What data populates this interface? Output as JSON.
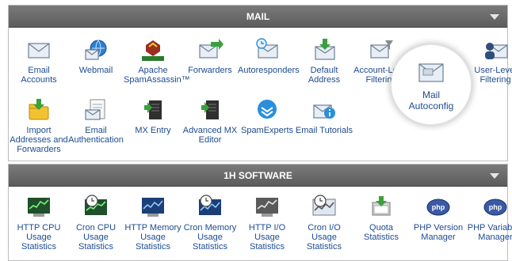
{
  "sections": {
    "mail": {
      "title": "MAIL",
      "items": [
        {
          "label": "Email Accounts",
          "icon": "email-envelope-icon"
        },
        {
          "label": "Webmail",
          "icon": "webmail-globe-icon"
        },
        {
          "label": "Apache SpamAssassin™",
          "icon": "spamassassin-icon"
        },
        {
          "label": "Forwarders",
          "icon": "forwarders-icon"
        },
        {
          "label": "Autoresponders",
          "icon": "autoresponders-icon"
        },
        {
          "label": "Default Address",
          "icon": "default-address-icon"
        },
        {
          "label": "Account-Level Filtering",
          "icon": "filter-envelope-icon"
        },
        {
          "label": "Mail Autoconfig",
          "icon": "mail-autoconfig-icon"
        },
        {
          "label": "User-Level Filtering",
          "icon": "user-filter-icon"
        },
        {
          "label": "Import Addresses and Forwarders",
          "icon": "import-folder-icon"
        },
        {
          "label": "Email Authentication",
          "icon": "email-auth-icon"
        },
        {
          "label": "MX Entry",
          "icon": "mx-server-icon"
        },
        {
          "label": "Advanced MX Editor",
          "icon": "advanced-mx-server-icon"
        },
        {
          "label": "SpamExperts",
          "icon": "spamexperts-icon"
        },
        {
          "label": "Email Tutorials",
          "icon": "email-tutorials-icon"
        }
      ]
    },
    "software": {
      "title": "1H SOFTWARE",
      "items": [
        {
          "label": "HTTP CPU Usage Statistics",
          "icon": "http-cpu-stats-icon"
        },
        {
          "label": "Cron CPU Usage Statistics",
          "icon": "cron-cpu-stats-icon"
        },
        {
          "label": "HTTP Memory Usage Statistics",
          "icon": "http-memory-stats-icon"
        },
        {
          "label": "Cron Memory Usage Statistics",
          "icon": "cron-memory-stats-icon"
        },
        {
          "label": "HTTP I/O Usage Statistics",
          "icon": "http-io-stats-icon"
        },
        {
          "label": "Cron I/O Usage Statistics",
          "icon": "cron-io-stats-icon"
        },
        {
          "label": "Quota Statistics",
          "icon": "quota-stats-icon"
        },
        {
          "label": "PHP Version Manager",
          "icon": "php-version-icon"
        },
        {
          "label": "PHP Variables Manager",
          "icon": "php-variables-icon"
        }
      ]
    }
  },
  "colors": {
    "header": "#666666",
    "link": "#1e4b8f"
  }
}
